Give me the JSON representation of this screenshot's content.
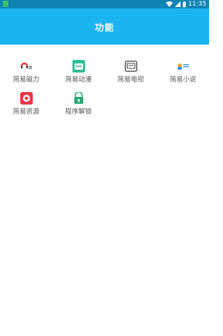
{
  "status_bar": {
    "time": "11:35",
    "icons": [
      "app-notification-icon",
      "wifi-icon",
      "signal-icon",
      "battery-icon"
    ]
  },
  "app_bar": {
    "title": "功能"
  },
  "features": [
    {
      "label": "简易磁力",
      "icon": "magnet-icon",
      "color": "#e53935"
    },
    {
      "label": "简易动漫",
      "icon": "anime-icon",
      "color": "#2bbf94"
    },
    {
      "label": "简易电视",
      "icon": "tv-icon",
      "color": "#444444"
    },
    {
      "label": "简易小说",
      "icon": "novel-icon",
      "color": "#2196f3"
    },
    {
      "label": "简易资源",
      "icon": "resource-icon",
      "color": "#e53945"
    },
    {
      "label": "程序解锁",
      "icon": "unlock-icon",
      "color": "#26a874"
    }
  ],
  "colors": {
    "status_bar": "#0f84b3",
    "app_bar": "#1ab4f2",
    "background": "#ffffff"
  }
}
